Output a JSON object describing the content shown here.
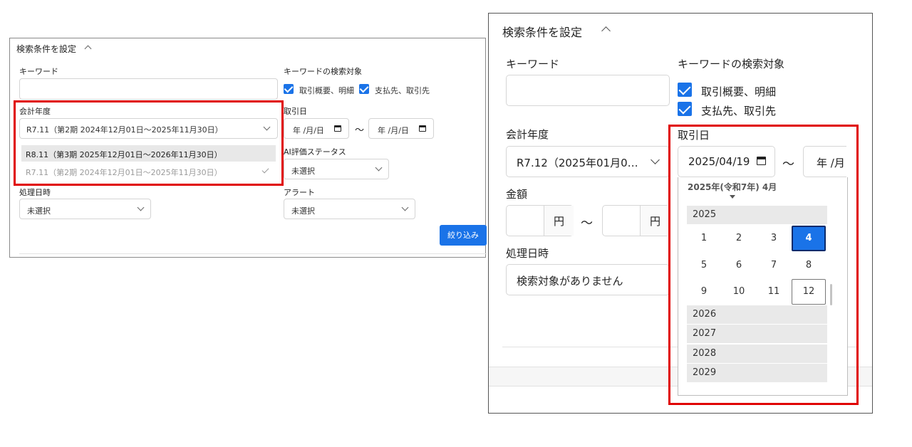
{
  "left": {
    "section_title": "検索条件を設定",
    "keyword_label": "キーワード",
    "keyword_value": "",
    "keyword_target_label": "キーワードの検索対象",
    "cb1_label": "取引概要、明細",
    "cb2_label": "支払先、取引先",
    "fiscal_label": "会計年度",
    "fiscal_selected": "R7.11（第2期 2024年12月01日〜2025年11月30日）",
    "fiscal_options": [
      "R8.11（第3期 2025年12月01日〜2026年11月30日）",
      "R7.11（第2期 2024年12月01日〜2025年11月30日）"
    ],
    "date_label": "取引日",
    "date_placeholder": "年 /月/日",
    "tilde": "〜",
    "ai_label": "AI評価ステータス",
    "ai_value": "未選択",
    "proc_label": "処理日時",
    "proc_value": "未選択",
    "alert_label": "アラート",
    "alert_value": "未選択",
    "filter_button": "絞り込み"
  },
  "right": {
    "section_title": "検索条件を設定",
    "keyword_label": "キーワード",
    "keyword_value": "",
    "keyword_target_label": "キーワードの検索対象",
    "cb1_label": "取引概要、明細",
    "cb2_label": "支払先、取引先",
    "fiscal_label": "会計年度",
    "fiscal_value": "R7.12（2025年01月0…",
    "date_label": "取引日",
    "date_from": "2025/04/19",
    "date_to_placeholder": "年 /月",
    "tilde": "〜",
    "amount_label": "金額",
    "yen": "円",
    "proc_label": "処理日時",
    "proc_value": "検索対象がありません",
    "picker": {
      "header": "2025年(令和7年) 4月",
      "year_current": "2025",
      "months": [
        "1",
        "2",
        "3",
        "4",
        "5",
        "6",
        "7",
        "8",
        "9",
        "10",
        "11",
        "12"
      ],
      "selected_month": "4",
      "years_after": [
        "2026",
        "2027",
        "2028",
        "2029"
      ]
    }
  },
  "colors": {
    "accent": "#1a73e8",
    "highlight": "#e00000"
  }
}
